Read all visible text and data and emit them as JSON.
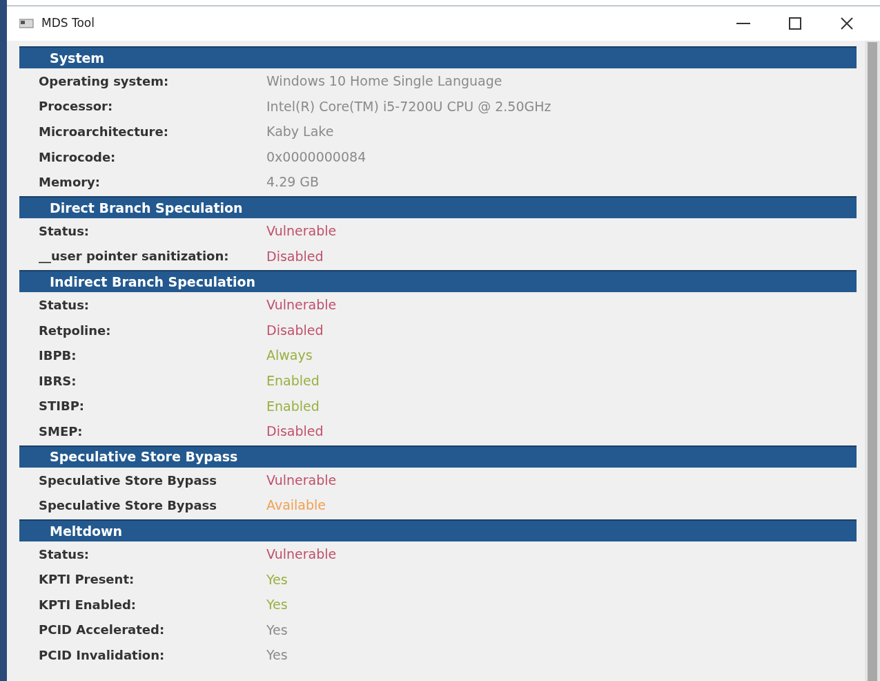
{
  "window": {
    "title": "MDS Tool"
  },
  "sections": [
    {
      "title": "System",
      "rows": [
        {
          "label": "Operating system:",
          "value": "Windows 10 Home Single Language",
          "color": "#8a8a8a"
        },
        {
          "label": "Processor:",
          "value": "Intel(R) Core(TM) i5-7200U CPU @ 2.50GHz",
          "color": "#8a8a8a"
        },
        {
          "label": "Microarchitecture:",
          "value": "Kaby Lake",
          "color": "#8a8a8a"
        },
        {
          "label": "Microcode:",
          "value": "0x0000000084",
          "color": "#8a8a8a"
        },
        {
          "label": "Memory:",
          "value": "4.29 GB",
          "color": "#8a8a8a"
        }
      ]
    },
    {
      "title": "Direct Branch Speculation",
      "rows": [
        {
          "label": "Status:",
          "value": "Vulnerable",
          "color": "#c0506a"
        },
        {
          "label": "__user pointer sanitization:",
          "value": "Disabled",
          "color": "#c0506a"
        }
      ]
    },
    {
      "title": "Indirect Branch Speculation",
      "rows": [
        {
          "label": "Status:",
          "value": "Vulnerable",
          "color": "#c0506a"
        },
        {
          "label": "Retpoline:",
          "value": "Disabled",
          "color": "#c0506a"
        },
        {
          "label": "IBPB:",
          "value": "Always",
          "color": "#98b040"
        },
        {
          "label": "IBRS:",
          "value": "Enabled",
          "color": "#98b040"
        },
        {
          "label": "STIBP:",
          "value": "Enabled",
          "color": "#98b040"
        },
        {
          "label": "SMEP:",
          "value": "Disabled",
          "color": "#c0506a"
        }
      ]
    },
    {
      "title": "Speculative Store Bypass",
      "rows": [
        {
          "label": "Speculative Store Bypass",
          "value": "Vulnerable",
          "color": "#c0506a"
        },
        {
          "label": "Speculative Store Bypass",
          "value": "Available",
          "color": "#f0a050"
        }
      ]
    },
    {
      "title": "Meltdown",
      "rows": [
        {
          "label": "Status:",
          "value": "Vulnerable",
          "color": "#c0506a"
        },
        {
          "label": "KPTI Present:",
          "value": "Yes",
          "color": "#98b040"
        },
        {
          "label": "KPTI Enabled:",
          "value": "Yes",
          "color": "#98b040"
        },
        {
          "label": "PCID Accelerated:",
          "value": "Yes",
          "color": "#8a8a8a"
        },
        {
          "label": "PCID Invalidation:",
          "value": "Yes",
          "color": "#8a8a8a"
        }
      ]
    }
  ]
}
